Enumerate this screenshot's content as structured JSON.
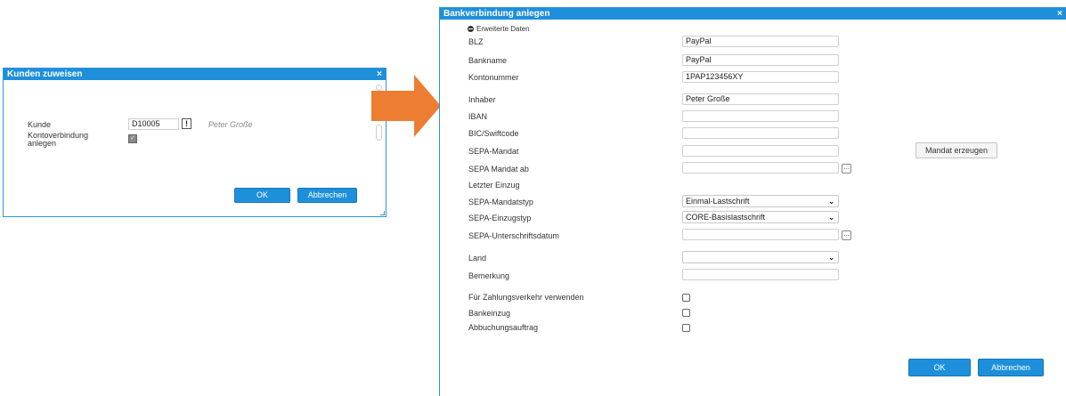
{
  "left_dialog": {
    "title": "Kunden zuweisen",
    "close": "×",
    "kunde_label": "Kunde",
    "kunde_value": "D10005",
    "warning": "!",
    "customer_name": "Peter Große",
    "kontoverbindung_label": "Kontoverbindung\nanlegen",
    "checkbox_mark": "✓",
    "ok": "OK",
    "cancel": "Abbrechen"
  },
  "right_dialog": {
    "title": "Bankverbindung anlegen",
    "close": "×",
    "section": "Erweiterte Daten",
    "fields": {
      "blz_label": "BLZ",
      "blz_value": "PayPal",
      "bankname_label": "Bankname",
      "bankname_value": "PayPal",
      "kontonummer_label": "Kontonummer",
      "kontonummer_value": "1PAP123456XY",
      "inhaber_label": "Inhaber",
      "inhaber_value": "Peter Große",
      "iban_label": "IBAN",
      "bic_label": "BIC/Swiftcode",
      "sepa_mandat_label": "SEPA-Mandat",
      "sepa_mandat_ab_label": "SEPA Mandat ab",
      "letzter_einzug_label": "Letzter Einzug",
      "mandatstyp_label": "SEPA-Mandatstyp",
      "mandatstyp_value": "Einmal-Lastschrift",
      "einzugstyp_label": "SEPA-Einzugstyp",
      "einzugstyp_value": "CORE-Basislastschrift",
      "unterschrift_label": "SEPA-Unterschriftsdatum",
      "land_label": "Land",
      "land_value": "",
      "bemerkung_label": "Bemerkung",
      "zahlungsverkehr_label": "Für Zahlungsverkehr verwenden",
      "bankeinzug_label": "Bankeinzug",
      "abbuchung_label": "Abbuchungsauftrag"
    },
    "date_button": "...",
    "mandat_button": "Mandat erzeugen",
    "ok": "OK",
    "cancel": "Abbrechen"
  },
  "colors": {
    "accent": "#1e90db",
    "arrow": "#ed7d31"
  }
}
